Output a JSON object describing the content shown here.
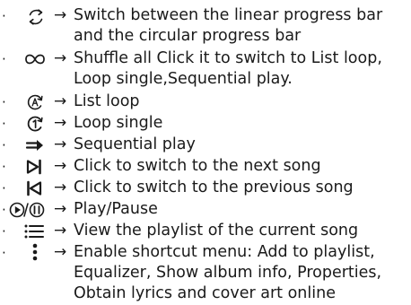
{
  "bullet": "·",
  "arrow": "→",
  "items": [
    {
      "icon": "switch-progress-icon",
      "lines": [
        "Switch between the linear progress bar",
        "and the circular progress bar"
      ]
    },
    {
      "icon": "shuffle-icon",
      "lines": [
        "Shuffle all Click it to switch to List loop,",
        "Loop single,Sequential play."
      ]
    },
    {
      "icon": "list-loop-icon",
      "lines": [
        "List loop"
      ]
    },
    {
      "icon": "loop-single-icon",
      "lines": [
        "Loop single"
      ]
    },
    {
      "icon": "sequential-play-icon",
      "lines": [
        "Sequential play"
      ]
    },
    {
      "icon": "next-song-icon",
      "lines": [
        "Click to switch to the next song"
      ]
    },
    {
      "icon": "previous-song-icon",
      "lines": [
        "Click to switch to the previous song"
      ]
    },
    {
      "icon": "play-pause-icon",
      "lines": [
        "Play/Pause"
      ]
    },
    {
      "icon": "playlist-icon",
      "lines": [
        "View the playlist of the current song"
      ]
    },
    {
      "icon": "more-menu-icon",
      "lines": [
        "Enable shortcut menu: Add to playlist,",
        "Equalizer, Show album info, Properties,",
        "Obtain lyrics  and cover art online"
      ]
    }
  ]
}
